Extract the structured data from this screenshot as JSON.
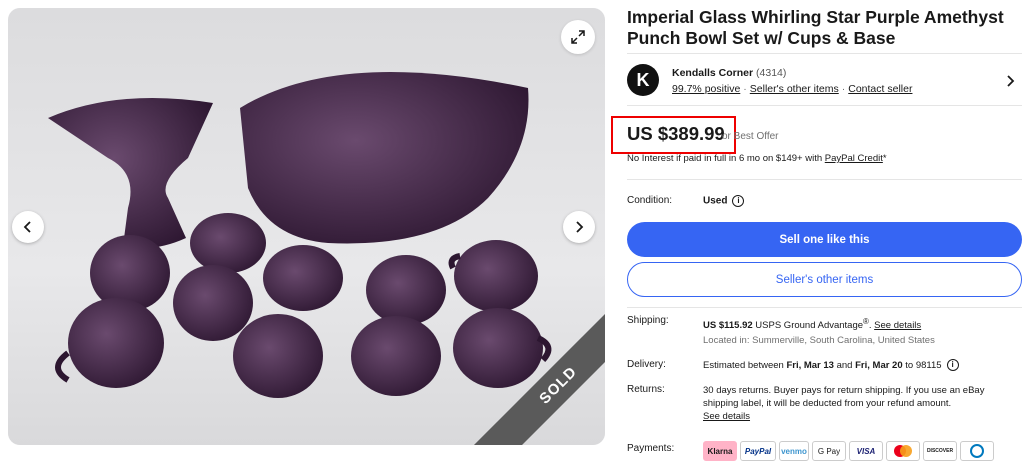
{
  "listing": {
    "title": "Imperial Glass Whirling Star Purple Amethyst Punch Bowl Set w/ Cups & Base",
    "sold_label": "SOLD"
  },
  "seller": {
    "logo_letter": "K",
    "name": "Kendalls Corner",
    "count": "(4314)",
    "positive": "99.7% positive",
    "other_items": "Seller's other items",
    "contact": "Contact seller",
    "sep": "·"
  },
  "price": {
    "amount": "US $389.99",
    "or_best_offer": "or Best Offer",
    "credit_text": "No Interest if paid in full in 6 mo on $149+ with ",
    "credit_link": "PayPal Credit",
    "credit_suffix": "*"
  },
  "condition": {
    "label": "Condition:",
    "value": "Used"
  },
  "buttons": {
    "sell": "Sell one like this",
    "other_items": "Seller's other items"
  },
  "shipping": {
    "label": "Shipping:",
    "cost": "US $115.92",
    "service": " USPS Ground Advantage",
    "reg": "®",
    "dot": ". ",
    "details": "See details",
    "location": "Located in: Summerville, South Carolina, United States"
  },
  "delivery": {
    "label": "Delivery:",
    "prefix": "Estimated between ",
    "start": "Fri, Mar 13",
    "and": " and ",
    "end": "Fri, Mar 20",
    "suffix": " to 98115"
  },
  "returns": {
    "label": "Returns:",
    "line1": "30 days returns. Buyer pays for return shipping. If you use an eBay",
    "line2": "shipping label, it will be deducted from your refund amount.",
    "details": "See details"
  },
  "payments": {
    "label": "Payments:",
    "methods": [
      "Klarna",
      "PayPal",
      "venmo",
      "G Pay",
      "VISA",
      "MC",
      "DISCOVER",
      "DC"
    ]
  },
  "colors": {
    "accent": "#3665f3",
    "highlight": "#e00000",
    "klarna": "#ffb3c7"
  }
}
